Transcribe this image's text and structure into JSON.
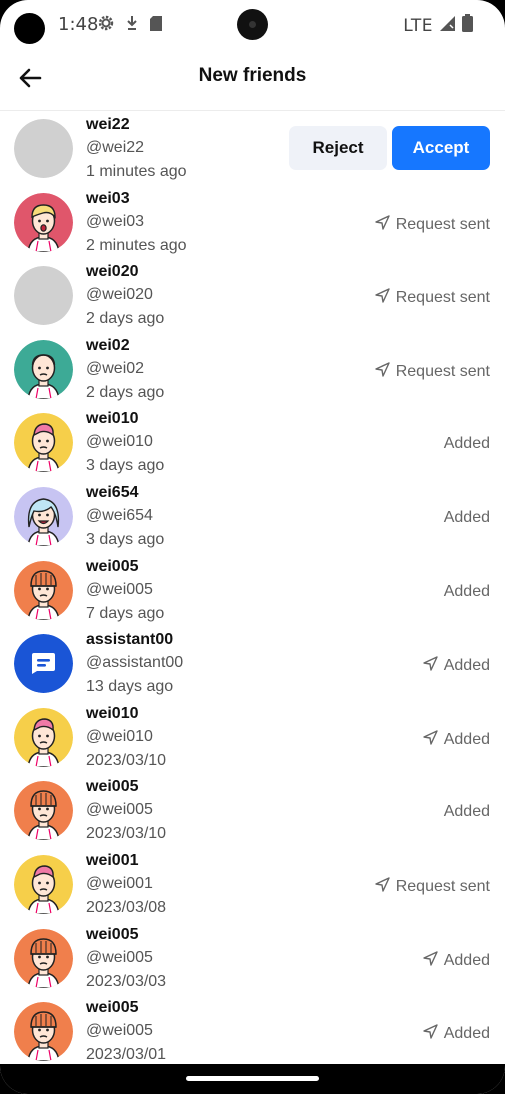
{
  "status_bar": {
    "time": "1:48",
    "network": "LTE"
  },
  "header": {
    "title": "New friends"
  },
  "actions": {
    "reject_label": "Reject",
    "accept_label": "Accept"
  },
  "colors": {
    "accent": "#1677ff",
    "reject_bg": "#eff2f8"
  },
  "friends": [
    {
      "name": "wei22",
      "handle": "@wei22",
      "time": "1 minutes ago",
      "status": "",
      "sent_icon": false,
      "avatar": "placeholder",
      "pending": true
    },
    {
      "name": "wei03",
      "handle": "@wei03",
      "time": "2 minutes ago",
      "status": "Request sent",
      "sent_icon": true,
      "avatar": "pink-surprised"
    },
    {
      "name": "wei020",
      "handle": "@wei020",
      "time": "2 days ago",
      "status": "Request sent",
      "sent_icon": true,
      "avatar": "placeholder"
    },
    {
      "name": "wei02",
      "handle": "@wei02",
      "time": "2 days ago",
      "status": "Request sent",
      "sent_icon": true,
      "avatar": "teal-bald"
    },
    {
      "name": "wei010",
      "handle": "@wei010",
      "time": "3 days ago",
      "status": "Added",
      "sent_icon": false,
      "avatar": "yellow-pinkhair"
    },
    {
      "name": "wei654",
      "handle": "@wei654",
      "time": "3 days ago",
      "status": "Added",
      "sent_icon": false,
      "avatar": "lavender-bluehair"
    },
    {
      "name": "wei005",
      "handle": "@wei005",
      "time": "7 days ago",
      "status": "Added",
      "sent_icon": false,
      "avatar": "orange-beanie"
    },
    {
      "name": "assistant00",
      "handle": "@assistant00",
      "time": "13 days ago",
      "status": "Added",
      "sent_icon": true,
      "avatar": "assistant-bot"
    },
    {
      "name": "wei010",
      "handle": "@wei010",
      "time": "2023/03/10",
      "status": "Added",
      "sent_icon": true,
      "avatar": "yellow-pinkhair"
    },
    {
      "name": "wei005",
      "handle": "@wei005",
      "time": "2023/03/10",
      "status": "Added",
      "sent_icon": false,
      "avatar": "orange-beanie"
    },
    {
      "name": "wei001",
      "handle": "@wei001",
      "time": "2023/03/08",
      "status": "Request sent",
      "sent_icon": true,
      "avatar": "yellow-pinkhair"
    },
    {
      "name": "wei005",
      "handle": "@wei005",
      "time": "2023/03/03",
      "status": "Added",
      "sent_icon": true,
      "avatar": "orange-beanie"
    },
    {
      "name": "wei005",
      "handle": "@wei005",
      "time": "2023/03/01",
      "status": "Added",
      "sent_icon": true,
      "avatar": "orange-beanie"
    }
  ]
}
